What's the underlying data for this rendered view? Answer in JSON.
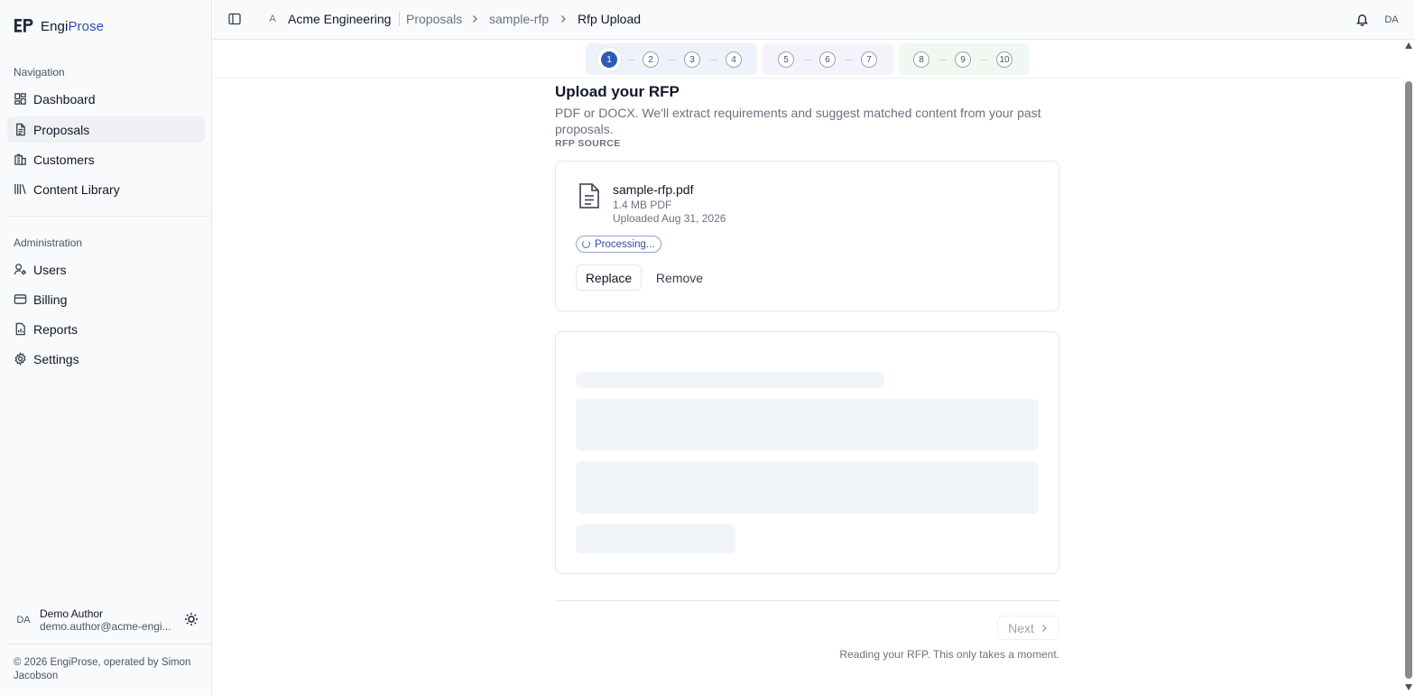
{
  "app": {
    "name_part1": "Engi",
    "name_part2": "Prose",
    "logo_icon": "ep-logo-icon"
  },
  "sidebar": {
    "navigation_label": "Navigation",
    "navigation_items": [
      {
        "label": "Dashboard",
        "icon": "dashboard-icon",
        "active": false
      },
      {
        "label": "Proposals",
        "icon": "document-icon",
        "active": true
      },
      {
        "label": "Customers",
        "icon": "building-icon",
        "active": false
      },
      {
        "label": "Content Library",
        "icon": "library-icon",
        "active": false
      }
    ],
    "administration_label": "Administration",
    "administration_items": [
      {
        "label": "Users",
        "icon": "user-cog-icon"
      },
      {
        "label": "Billing",
        "icon": "credit-card-icon"
      },
      {
        "label": "Reports",
        "icon": "report-icon"
      },
      {
        "label": "Settings",
        "icon": "gear-icon"
      }
    ],
    "user": {
      "initials": "DA",
      "name": "Demo Author",
      "email": "demo.author@acme-engi..."
    },
    "copyright": "© 2026 EngiProse, operated by Simon Jacobson"
  },
  "header": {
    "workspace_initial": "A",
    "workspace_name": "Acme Engineering",
    "breadcrumbs": [
      "Proposals",
      "sample-rfp",
      "Rfp Upload"
    ],
    "user_initials": "DA"
  },
  "stepper": {
    "current_step": 1,
    "groups": [
      {
        "steps": [
          "1",
          "2",
          "3",
          "4"
        ],
        "color": "#eef2fb"
      },
      {
        "steps": [
          "5",
          "6",
          "7"
        ],
        "color": "#f6f2fb"
      },
      {
        "steps": [
          "8",
          "9",
          "10"
        ],
        "color": "#f0f8f1"
      }
    ]
  },
  "main": {
    "title": "Upload your RFP",
    "subtitle": "PDF or DOCX. We'll extract requirements and suggest matched content from your past proposals.",
    "section_label": "RFP SOURCE",
    "file": {
      "name": "sample-rfp.pdf",
      "size": "1.4 MB PDF",
      "uploaded": "Uploaded Aug 31, 2026",
      "status": "Processing...",
      "replace_label": "Replace",
      "remove_label": "Remove"
    },
    "next_label": "Next",
    "footer_hint": "Reading your RFP. This only takes a moment."
  },
  "colors": {
    "accent": "#2f5bb7",
    "brand_secondary": "#2f4fb2",
    "muted_text": "#6b7280"
  }
}
